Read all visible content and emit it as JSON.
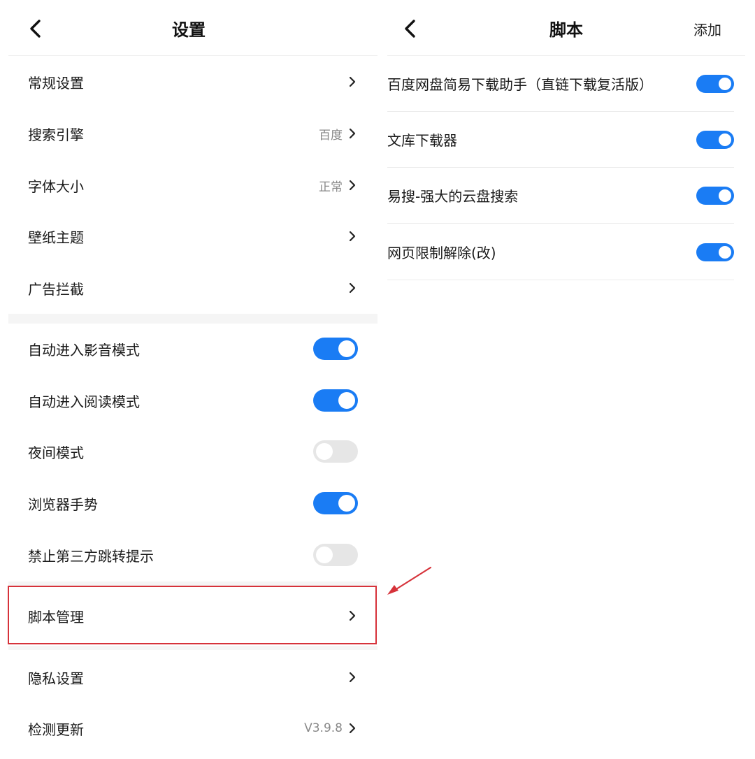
{
  "settings": {
    "title": "设置",
    "rows_nav": [
      {
        "label": "常规设置",
        "value": ""
      },
      {
        "label": "搜索引擎",
        "value": "百度"
      },
      {
        "label": "字体大小",
        "value": "正常"
      },
      {
        "label": "壁纸主题",
        "value": ""
      },
      {
        "label": "广告拦截",
        "value": ""
      }
    ],
    "rows_toggle": [
      {
        "label": "自动进入影音模式",
        "on": true
      },
      {
        "label": "自动进入阅读模式",
        "on": true
      },
      {
        "label": "夜间模式",
        "on": false
      },
      {
        "label": "浏览器手势",
        "on": true
      },
      {
        "label": "禁止第三方跳转提示",
        "on": false
      }
    ],
    "script_manage": {
      "label": "脚本管理"
    },
    "rows_bottom": [
      {
        "label": "隐私设置",
        "value": ""
      },
      {
        "label": "检测更新",
        "value": "V3.9.8"
      }
    ]
  },
  "scripts": {
    "title": "脚本",
    "add_label": "添加",
    "items": [
      {
        "label": "百度网盘简易下载助手（直链下载复活版）",
        "on": true
      },
      {
        "label": "文库下载器",
        "on": true
      },
      {
        "label": "易搜-强大的云盘搜索",
        "on": true
      },
      {
        "label": "网页限制解除(改)",
        "on": true
      }
    ]
  },
  "colors": {
    "accent": "#1a7cf4",
    "toggle_off": "#e6e6e6",
    "highlight": "#d6323a"
  }
}
